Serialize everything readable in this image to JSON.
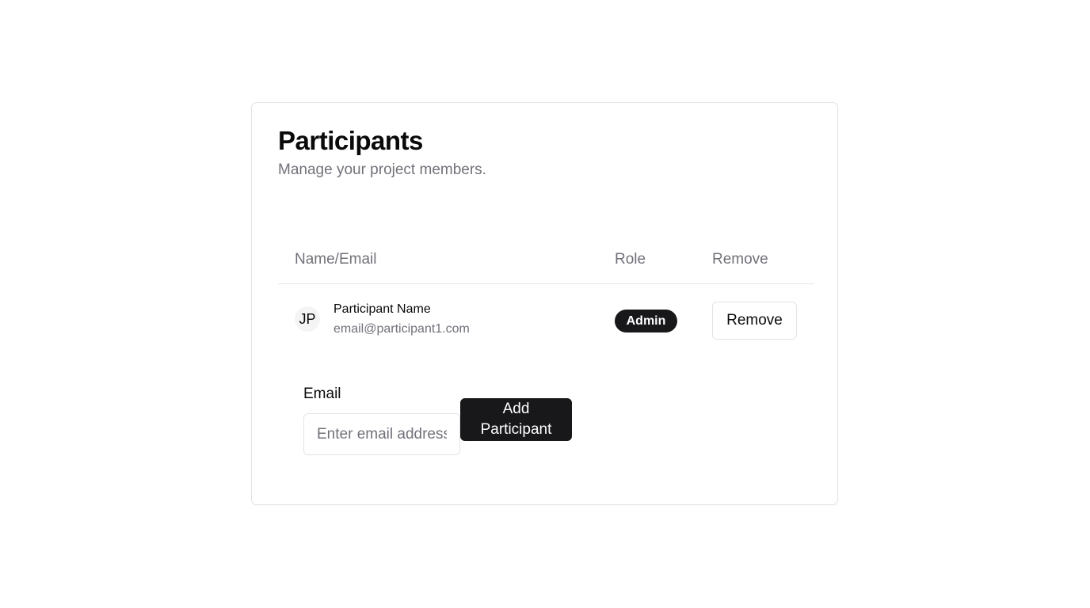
{
  "card": {
    "title": "Participants",
    "subtitle": "Manage your project members."
  },
  "table": {
    "columns": [
      "Name/Email",
      "Role",
      "Remove"
    ],
    "rows": [
      {
        "initials": "JP",
        "name": "Participant Name",
        "email": "email@participant1.com",
        "role": "Admin",
        "remove_label": "Remove"
      }
    ]
  },
  "add_form": {
    "email_label": "Email",
    "email_placeholder": "Enter email address",
    "email_value": "",
    "add_label": "Add Participant"
  },
  "colors": {
    "primary": "#18181b",
    "muted_text": "#71717a",
    "border": "#e4e4e7"
  }
}
